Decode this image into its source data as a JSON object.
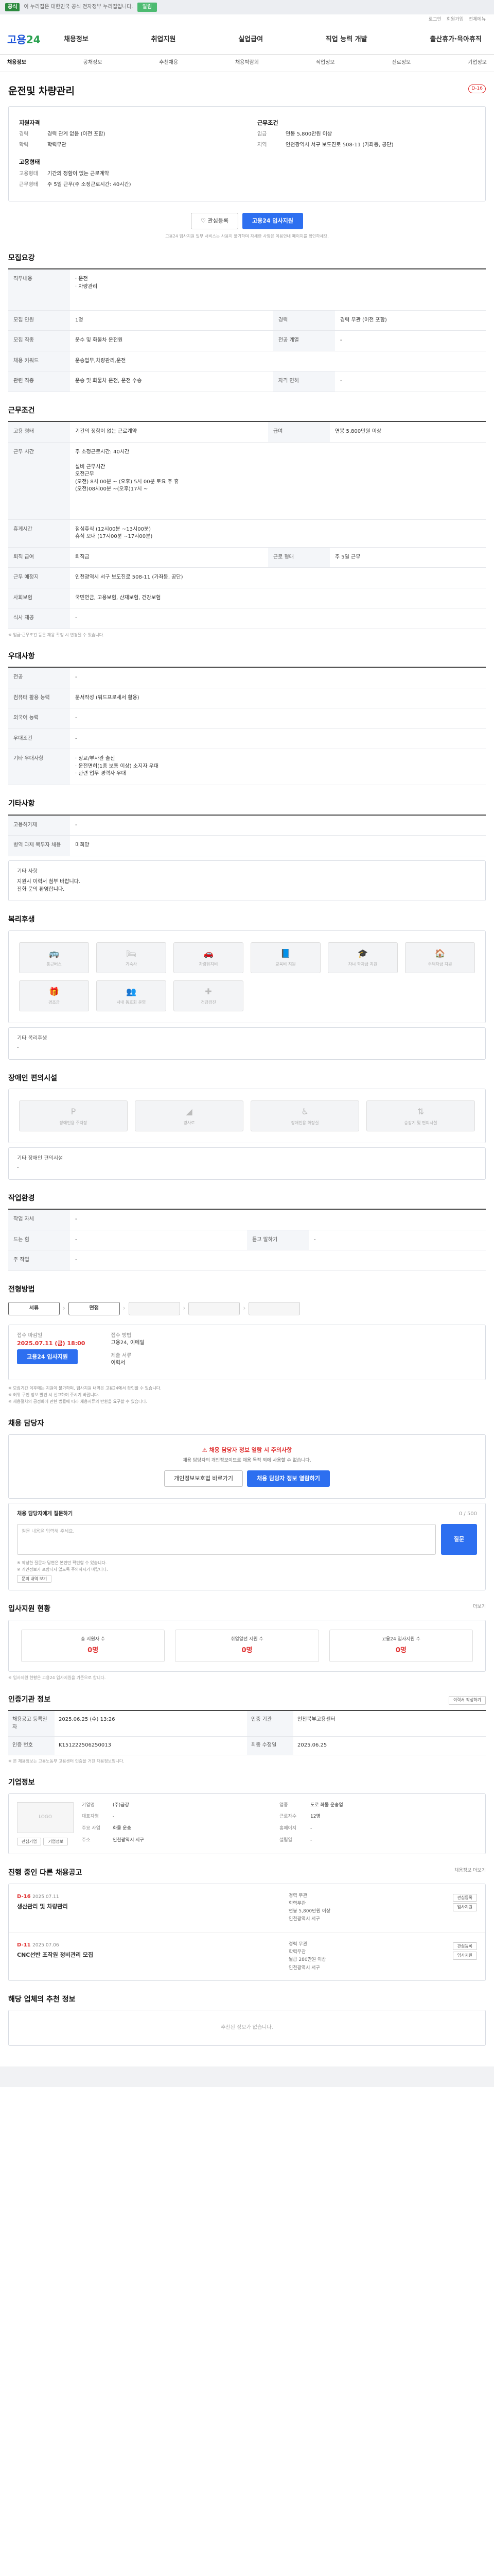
{
  "topbar": {
    "badge": "공식",
    "text": "이 누리집은 대한민국 공식 전자정부 누리집입니다.",
    "alert": "알림"
  },
  "util": [
    "로그인",
    "회원가입",
    "전체메뉴"
  ],
  "site": {
    "logo_a": "고용",
    "logo_b": "24"
  },
  "gnb": [
    "채용정보",
    "취업지원",
    "실업급여",
    "직업 능력 개발",
    "출산휴가·육아휴직"
  ],
  "lnb": [
    "채용정보",
    "공채정보",
    "추천채용",
    "채용박람회",
    "직업정보",
    "진로정보",
    "기업정보"
  ],
  "job": {
    "title": "운전및 차량관리",
    "dday": "D-16"
  },
  "summary": {
    "h1": "지원자격",
    "h2": "근무조건",
    "left": [
      {
        "k": "경력",
        "v": "경력 관계 없음 (이전 포함)"
      },
      {
        "k": "학력",
        "v": "학력무관"
      }
    ],
    "h3": "고용형태",
    "left2": [
      {
        "k": "고용형태",
        "v": "기간의 정함이 없는 근로계약"
      },
      {
        "k": "근무형태",
        "v": "주 5일 근무(주 소정근로시간: 40시간)"
      }
    ],
    "right": [
      {
        "k": "임금",
        "v": "연봉 5,800만원 이상"
      },
      {
        "k": "지역",
        "v": "인천광역시 서구 보도진로 508-11 (가좌동, 공단)"
      }
    ]
  },
  "buttons": {
    "scrap": "관심등록",
    "apply": "고용24 입사지원"
  },
  "summary_note": "고용24 입사지원 일부 서비스는 사용이 불가하며 자세한 사항은 이용안내 페이지를 확인하세요.",
  "sec_recruit": {
    "title": "모집요강",
    "rows": [
      {
        "k": "직무내용",
        "v": "· 운전\n· 차량관리",
        "tag": ""
      },
      {
        "k": "모집 인원",
        "v": "1명"
      },
      {
        "k": "모집 직종",
        "v": "운수 및 화물차 운전원"
      },
      {
        "k": "채용 키워드",
        "v": "운송업무,차량관리,운전"
      },
      {
        "k": "관련 직종",
        "v": "운송 및 화물차 운전, 운전 수송",
        "tag": ""
      },
      {
        "k": "경력",
        "v": "경력 무관 (이전 포함)"
      },
      {
        "k": "전공 계열",
        "v": "-"
      },
      {
        "k": "자격 면허",
        "v": "-"
      }
    ]
  },
  "sec_cond": {
    "title": "근무조건",
    "rows": [
      {
        "k": "고용 형태",
        "v": "기간의 정함이 없는 근로계약"
      },
      {
        "k": "근무 시간",
        "v": "주 소정근로시간: 40시간\n\n설비 근무시간\n오전근무\n(오전) 8시 00분 ~ (오후) 5시 00분 토요 주 휴\n(오전)08시00분 ~(오후)17시 ~"
      },
      {
        "k": "휴게시간",
        "v": "점심휴식 (12시00분 ~13시00분)\n휴식 보내 (17시00분 ~17시00분)"
      },
      {
        "k": "급여",
        "v": "연봉 5,800만원 이상"
      },
      {
        "k": "퇴직 급여",
        "v": "퇴직금"
      },
      {
        "k": "근무 예정지",
        "v": "인천광역시 서구 보도진로 508-11 (가좌동, 공단)"
      },
      {
        "k": "사회보험",
        "v": "국민연금, 고용보험, 산재보험, 건강보험"
      },
      {
        "k": "식사 제공",
        "v": "-"
      },
      {
        "k": "근로 형태",
        "v": "주 5일 근무"
      }
    ],
    "note": "※ 임금·근무조건 등은 채용 확정 시 변경될 수 있습니다."
  },
  "sec_pref": {
    "title": "우대사항",
    "rows": [
      {
        "k": "전공",
        "v": "-"
      },
      {
        "k": "컴퓨터 활용 능력",
        "v": "문서작성 (워드프로세서 활용)"
      },
      {
        "k": "외국어 능력",
        "v": "-"
      },
      {
        "k": "우대조건",
        "v": "-"
      },
      {
        "k": "기타 우대사항",
        "v": "· 장교/부사관 출신\n· 운전면허(1종 보통 이상) 소지자 우대\n· 관련 업무 경력자 우대"
      }
    ]
  },
  "sec_etc": {
    "title": "기타사항",
    "rows": [
      {
        "k": "고용허가제",
        "v": "-"
      },
      {
        "k": "병역 과제 복무자 채용",
        "v": "미희망"
      }
    ],
    "text_label": "기타 사항",
    "text": "지원시 이력서 첨부 바랍니다.\n전화 문의 환영합니다."
  },
  "sec_welfare": {
    "title": "복리후생",
    "items": [
      "통근버스",
      "기숙사",
      "차량유지비",
      "교육비 지원",
      "자녀 학자금 지원",
      "주택자금 지원",
      "경조금",
      "사내 동호회 운영",
      "건강검진",
      "",
      "",
      ""
    ],
    "other_label": "기타 복리후생",
    "other": "-"
  },
  "sec_disab": {
    "title": "장애인 편의시설",
    "items": [
      "장애인용 주차장",
      "경사로",
      "장애인용 화장실",
      "승강기 및 편의시설"
    ],
    "other_label": "기타 장애인 편의시설",
    "other": "-"
  },
  "sec_workenv": {
    "title": "작업환경",
    "rows": [
      {
        "k": "작업 자세",
        "v": "-",
        "k2": "",
        "v2": ""
      },
      {
        "k": "드는 힘",
        "v": "-",
        "k2": "",
        "v2": ""
      },
      {
        "k": "듣고 말하기",
        "v": "-",
        "k2": "",
        "v2": ""
      },
      {
        "k": "주 작업",
        "v": "-",
        "k2": "",
        "v2": ""
      }
    ]
  },
  "sec_process": {
    "title": "전형방법",
    "steps": [
      "서류",
      "면접",
      "",
      "",
      ""
    ],
    "apply_label": "접수 마감일",
    "apply_date": "2025.07.11 (금) 18:00",
    "apply_btn": "고용24 입사지원",
    "method_label": "접수 방법",
    "method": "고용24, 이메일",
    "doc_label": "제출 서류",
    "doc": "이력서",
    "notice": "※ 모집기간 이후에는 지원이 불가하며, 입사지원 내역은 고용24에서 확인할 수 있습니다.\n※ 허위 구인 정보 발견 시 신고하여 주시기 바랍니다.\n※ 채용절차의 공정화에 관한 법률에 따라 채용서류의 반환을 요구할 수 있습니다."
  },
  "sec_qa": {
    "title": "채용 담당자",
    "warn": "채용 담당자 정보 열람 시 주의사항",
    "desc": "채용 담당자의 개인정보이므로 채용 목적 외에 사용할 수 없습니다.",
    "btn1": "개인정보보호법 바로가기",
    "btn2": "채용 담당자 정보 열람하기",
    "q_title": "채용 담당자에게 질문하기",
    "q_count": "0 / 500",
    "q_placeholder": "질문 내용을 입력해 주세요.",
    "q_btn": "질문",
    "q_notes": "※ 작성한 질문과 답변은 본인만 확인할 수 있습니다.\n※ 개인정보가 포함되지 않도록 주의하시기 바랍니다.",
    "q_link": "문의 내역 보기"
  },
  "sec_status": {
    "title": "입사지원 현황",
    "more": "더보기",
    "cards": [
      {
        "t": "총 지원자 수",
        "n": "0명"
      },
      {
        "t": "취업알선 지원 수",
        "n": "0명"
      },
      {
        "t": "고용24 입사지원 수",
        "n": "0명"
      }
    ],
    "note": "※ 입사지원 현황은 고용24 입사지원을 기준으로 합니다."
  },
  "sec_info": {
    "title": "인증기관 정보",
    "btn": "이력서 작성하기",
    "rows": [
      {
        "h": "채용공고 등록일자",
        "v": "2025.06.25 (수) 13:26",
        "h2": "인증 기관",
        "v2": "인천북부고용센터"
      },
      {
        "h": "인증 번호",
        "v": "K151222506250013",
        "h2": "최종 수정일",
        "v2": "2025.06.25"
      }
    ],
    "note": "※ 본 채용정보는 고용노동부 고용센터 인증을 거친 채용정보입니다."
  },
  "sec_comp": {
    "title": "기업정보",
    "logo": "LOGO",
    "btn1": "관심기업",
    "btn2": "기업정보",
    "grid": [
      {
        "k": "기업명",
        "v": "(주)금강"
      },
      {
        "k": "업종",
        "v": "도로 화물 운송업"
      },
      {
        "k": "대표자명",
        "v": "-"
      },
      {
        "k": "근로자수",
        "v": "12명"
      },
      {
        "k": "주요 사업",
        "v": "화물 운송"
      },
      {
        "k": "홈페이지",
        "v": "-"
      },
      {
        "k": "주소",
        "v": "인천광역시 서구"
      },
      {
        "k": "설립일",
        "v": "-"
      }
    ]
  },
  "sec_other": {
    "title": "진행 중인 다른 채용공고",
    "more": "채용정보 더보기",
    "items": [
      {
        "dd": "D-16",
        "date": "2025.07.11",
        "ttl": "생산관리 및 차량관리",
        "m1": "경력 무관",
        "m2": "학력무관",
        "m3": "연봉 5,800만원 이상",
        "m4": "인천광역시 서구",
        "btn1": "관심등록",
        "btn2": "입사지원"
      },
      {
        "dd": "D-11",
        "date": "2025.07.06",
        "ttl": "CNC선반 조작원 정비관리 모집",
        "m1": "경력 무관",
        "m2": "학력무관",
        "m3": "월급 280만원 이상",
        "m4": "인천광역시 서구",
        "btn1": "관심등록",
        "btn2": "입사지원"
      }
    ]
  },
  "sec_same": {
    "title": "해당 업체의 추천 정보",
    "empty": "추천된 정보가 없습니다."
  }
}
